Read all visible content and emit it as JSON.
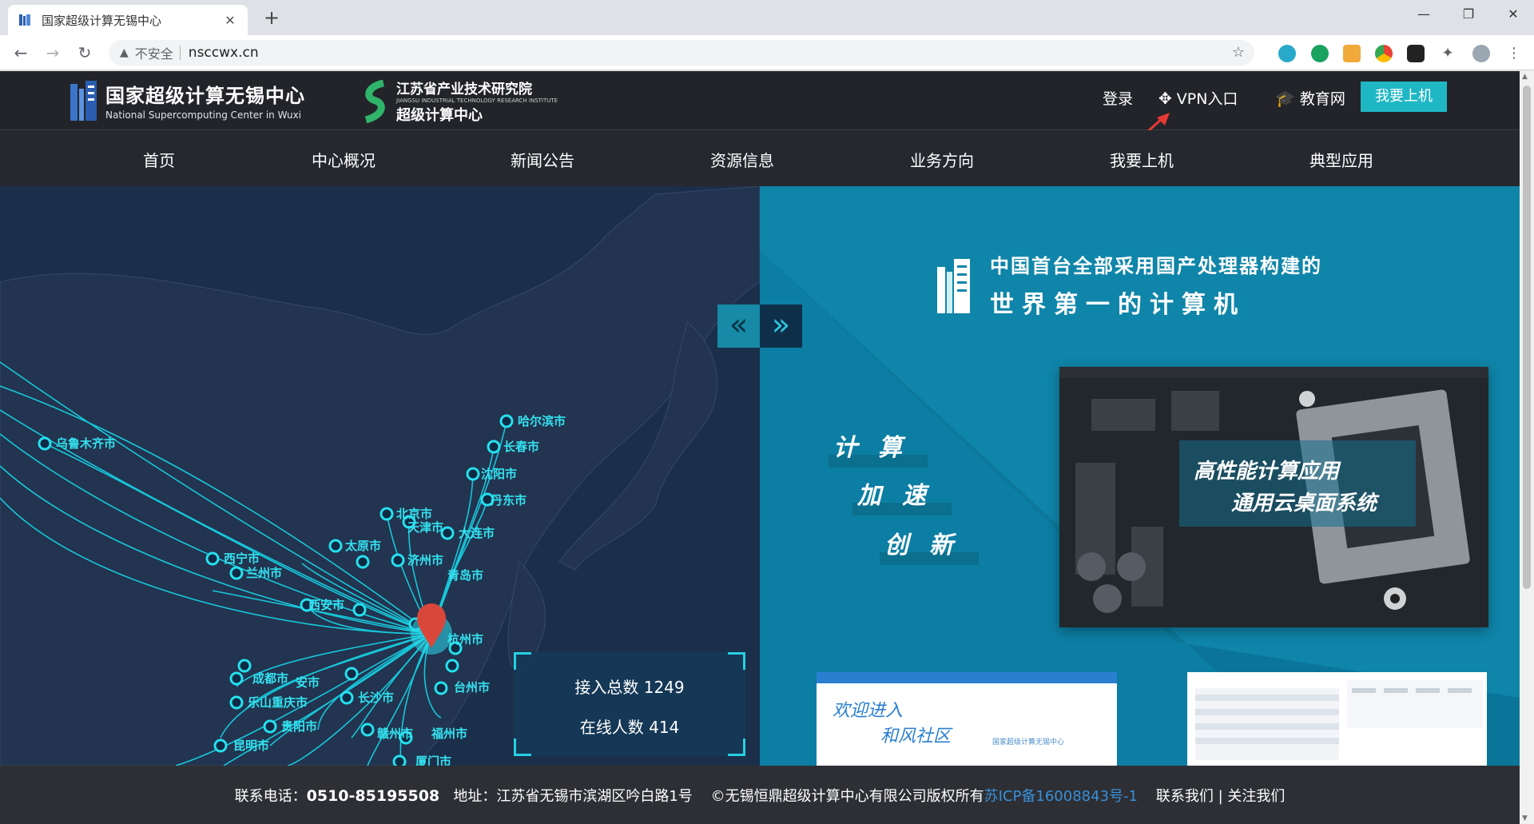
{
  "browser": {
    "tab_title": "国家超级计算无锡中心",
    "tab_close": "✕",
    "new_tab": "+",
    "security_label": "不安全",
    "url": "nsccwx.cn",
    "window_controls": [
      "—",
      "❐",
      "✕"
    ]
  },
  "header": {
    "logo_main_cn": "国家超级计算无锡中心",
    "logo_main_en": "National Supercomputing Center in Wuxi",
    "logo_partner_cn": "江苏省产业技术研究院",
    "logo_partner_en": "JIANGSU INDUSTRIAL TECHNOLOGY RESEARCH INSTITUTE",
    "logo_partner_sub": "超级计算中心",
    "login": "登录",
    "vpn": "VPN入口",
    "education": "教育网",
    "go_online": "我要上机"
  },
  "nav": {
    "items": [
      "首页",
      "中心概况",
      "新闻公告",
      "资源信息",
      "业务方向",
      "我要上机",
      "典型应用"
    ]
  },
  "banner": {
    "prev": "«",
    "next": "»",
    "slogan_line1": "中国首台全部采用国产处理器构建的",
    "slogan_line2": "世界第一的计算机",
    "keywords": [
      "计算",
      "加速",
      "创新"
    ],
    "chip_line1": "高性能计算应用",
    "chip_line2": "通用云桌面系统",
    "thumb_welcome_1": "欢迎进入",
    "thumb_welcome_2": "和风社区",
    "thumb_sub": "国家超级计算无锡中心"
  },
  "map": {
    "cities": [
      "哈尔滨市",
      "长春市",
      "沈阳市",
      "乌鲁木齐市",
      "北京市",
      "天津市",
      "大连市",
      "丹东市",
      "太原市",
      "济州市",
      "青岛市",
      "西宁市",
      "兰州市",
      "西安市",
      "成都市",
      "安市",
      "乐山重庆市",
      "贵阳市",
      "昆明市",
      "长沙市",
      "福州市",
      "台州市",
      "赣州市",
      "厦门市",
      "杭州市"
    ]
  },
  "stats": {
    "total": "接入总数 1249",
    "online": "在线人数 414"
  },
  "footer": {
    "phone_label": "联系电话：",
    "phone": "0510-85195508",
    "address": "地址：江苏省无锡市滨湖区吟白路1号",
    "copyright": "©无锡恒鼎超级计算中心有限公司版权所有",
    "icp": "苏ICP备16008843号-1",
    "links": "联系我们 | 关注我们"
  }
}
